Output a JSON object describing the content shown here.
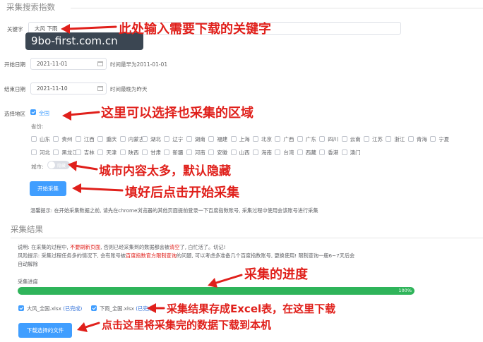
{
  "search": {
    "section_title": "采集搜索指数",
    "keyword_label": "关键字",
    "keyword_value": "大风 下雨",
    "start_label": "开始日期",
    "start_value": "2021-11-01",
    "start_hint": "时间最早为2011-01-01",
    "end_label": "结束日期",
    "end_value": "2021-11-10",
    "end_hint": "时间最晚为昨天",
    "region_label": "选择地区",
    "nationwide": "全国",
    "province_label": "省份:",
    "provinces_row1": [
      "山东",
      "贵州",
      "江西",
      "重庆",
      "内蒙古",
      "湖北",
      "辽宁",
      "湖南",
      "福建",
      "上海",
      "北京",
      "广西",
      "广东",
      "四川",
      "云南",
      "江苏",
      "浙江",
      "青海",
      "宁夏"
    ],
    "provinces_row2": [
      "河北",
      "黑龙江",
      "吉林",
      "天津",
      "陕西",
      "甘肃",
      "新疆",
      "河南",
      "安徽",
      "山西",
      "海南",
      "台湾",
      "西藏",
      "香港",
      "澳门"
    ],
    "city_label": "城市:",
    "city_toggle": "隐藏",
    "start_button": "开始采集",
    "tip": "温馨提示: 在开始采集数据之前, 请先在chrome浏览器的其他页面提前登录一下百度指数账号, 采集过程中使用会该账号进行采集"
  },
  "results": {
    "section_title": "采集结果",
    "note_1a": "说明: 在采集的过程中, ",
    "note_1b": "不要刷新页面",
    "note_1c": ", 否则已经采集到的数据都会被",
    "note_1d": "清空",
    "note_1e": "了, 白忙活了。切记!",
    "note_2a": "风险提示: 采集过程任务多的情况下, 会有账号被",
    "note_2b": "百度指数官方限制查询",
    "note_2c": "的问题, 可以考虑多准备几个百度指数账号, 更换使用! 限制查询一般6~7天后会",
    "note_3": "自动解除",
    "progress_label": "采集进度",
    "progress_value": 100,
    "progress_text": "100%",
    "files": [
      {
        "name": "大风_全国.xlsx",
        "status": "(已完成)"
      },
      {
        "name": "下雨_全国.xlsx",
        "status": "(已完成)"
      }
    ],
    "download_button": "下载选择的文件"
  },
  "annotations": {
    "a1": "此处输入需要下载的关键字",
    "a2": "这里可以选择也采集的区域",
    "a3": "城市内容太多，默认隐藏",
    "a4": "填好后点击开始采集",
    "a5": "采集的进度",
    "a6": "采集结果存成Excel表，在这里下载",
    "a7": "点击这里将采集完的数据下载到本机"
  },
  "watermark": "9bo-first.com.cn",
  "colors": {
    "accent": "#409eff",
    "progress": "#2fb45a",
    "annotation": "#e0201b"
  }
}
